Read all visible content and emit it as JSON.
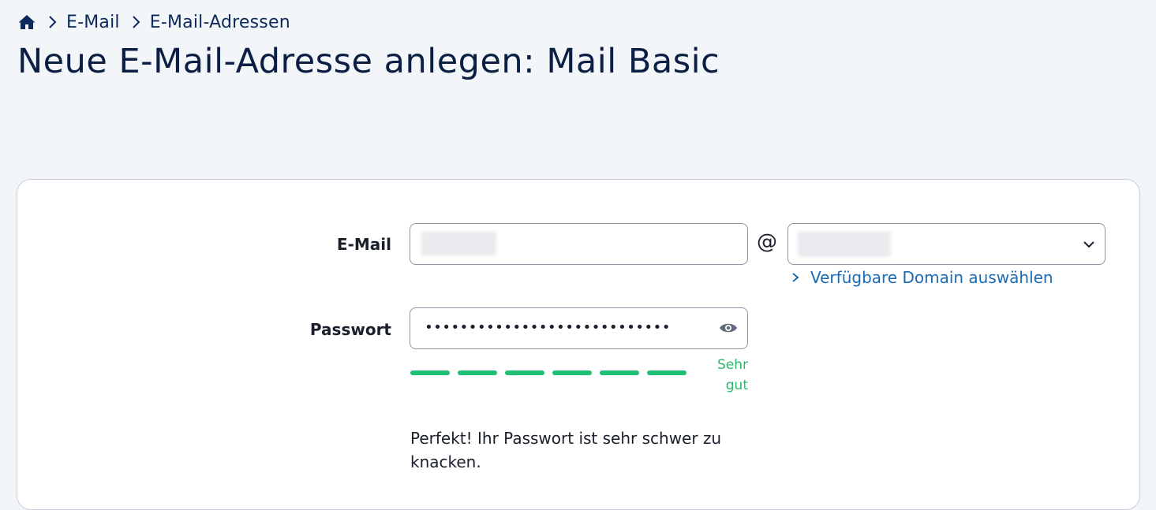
{
  "breadcrumb": {
    "home_icon": "home-icon",
    "items": [
      "E-Mail",
      "E-Mail-Adressen"
    ]
  },
  "page_title": "Neue E-Mail-Adresse anlegen: Mail Basic",
  "form": {
    "email": {
      "label": "E-Mail",
      "value": "",
      "at_sign": "@",
      "domain_value": "",
      "domain_link": "Verfügbare Domain auswählen"
    },
    "password": {
      "label": "Passwort",
      "masked_value": "••••••••••••••••••••••••••••",
      "toggle_icon": "eye-icon",
      "strength_segments_filled": 6,
      "strength_segments_total": 6,
      "strength_label_line1": "Sehr",
      "strength_label_line2": "gut",
      "message": "Perfekt! Ihr Passwort ist sehr schwer zu knacken."
    }
  },
  "colors": {
    "background": "#f3f6f9",
    "title": "#0b1f44",
    "link": "#1a6bb3",
    "strength": "#1fbf75"
  }
}
